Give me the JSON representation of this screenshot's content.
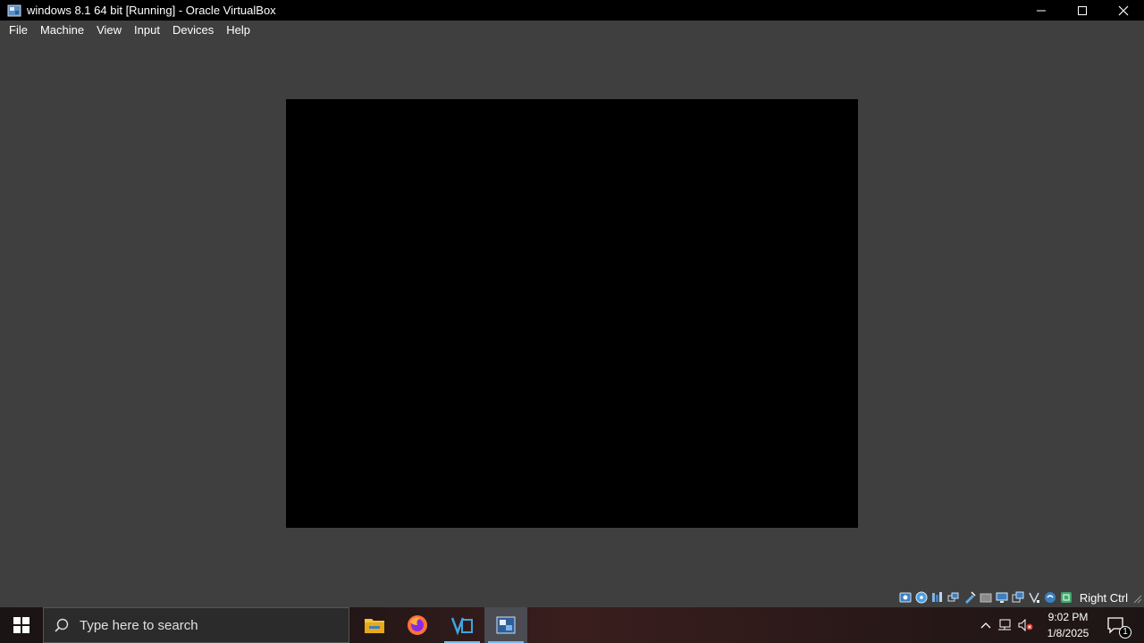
{
  "window": {
    "title": "windows 8.1 64 bit [Running] - Oracle VirtualBox",
    "minimize_glyph": "─",
    "maximize_glyph": "☐",
    "close_glyph": "✕"
  },
  "menu": {
    "items": [
      {
        "label": "File"
      },
      {
        "label": "Machine"
      },
      {
        "label": "View"
      },
      {
        "label": "Input"
      },
      {
        "label": "Devices"
      },
      {
        "label": "Help"
      }
    ]
  },
  "vm": {
    "screen_color": "#000000"
  },
  "statusbar": {
    "icons": [
      "hard-disk-icon",
      "optical-drive-icon",
      "audio-icon",
      "network-icon",
      "usb-icon",
      "shared-folders-icon",
      "display-icon",
      "video-capture-icon",
      "cpu-icon",
      "mouse-integration-icon",
      "keyboard-icon"
    ],
    "host_key_label": "Right Ctrl"
  },
  "taskbar": {
    "search_placeholder": "Type here to search",
    "apps": [
      "file-explorer-icon",
      "firefox-icon",
      "visual-studio-icon",
      "virtualbox-icon"
    ],
    "active_app": "virtualbox-icon",
    "clock_time": "9:02 PM",
    "clock_date": "1/8/2025",
    "notification_count": "1",
    "accent_color": "#76b9ed"
  }
}
